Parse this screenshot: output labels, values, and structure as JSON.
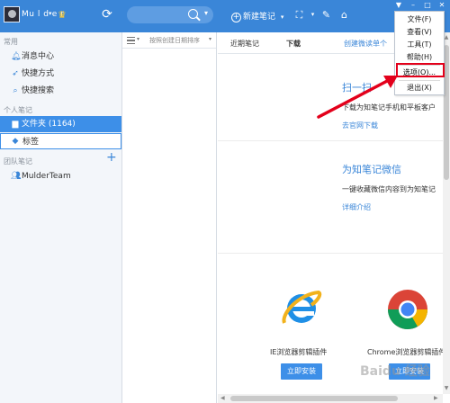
{
  "header": {
    "username": "Mu l d e r",
    "new_note_label": "新建笔记",
    "caret": "▾"
  },
  "menu": {
    "items": [
      "文件(F)",
      "查看(V)",
      "工具(T)",
      "帮助(H)",
      "选项(O)...",
      "退出(X)"
    ]
  },
  "sidebar": {
    "section_common": "常用",
    "items_common": [
      "消息中心",
      "快捷方式",
      "快捷搜索"
    ],
    "section_personal": "个人笔记",
    "folder_label": "文件夹 (1164)",
    "tag_label": "标签",
    "section_team": "团队笔记",
    "team_item": "MulderTeam"
  },
  "list": {
    "sort_label": "按照创建日期排序"
  },
  "content": {
    "tabs": [
      "近期笔记",
      "下载",
      "创建微读单个"
    ],
    "scan_heading": "扫一扫",
    "scan_text": "下载为知笔记手机和平板客户",
    "scan_link": "去官网下载",
    "wechat_heading": "为知笔记微信",
    "wechat_text": "一键收藏微信内容到为知笔记",
    "wechat_link": "详细介绍",
    "ie_label": "IE浏览器剪辑插件",
    "ie_button": "立即安装",
    "chrome_label": "Chrome浏览器剪辑插件",
    "chrome_button": "立即安装"
  },
  "watermark": "Baidu 经验",
  "colors": {
    "accent": "#3a86d8",
    "selected": "#3d8fe8",
    "highlight_box": "#e3001b"
  }
}
